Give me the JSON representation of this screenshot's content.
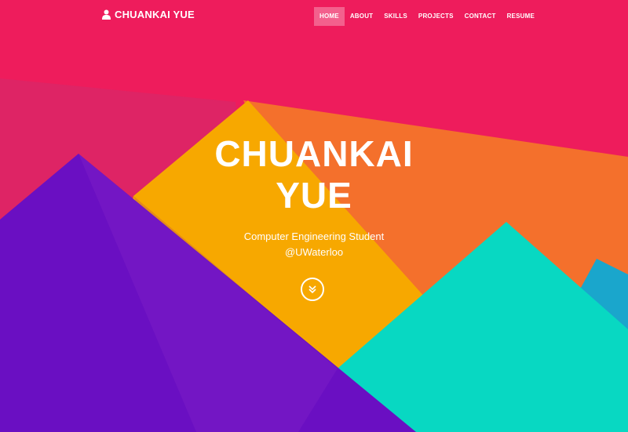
{
  "nav": {
    "brand": "CHUANKAI YUE",
    "brand_icon": "user-icon",
    "items": [
      {
        "label": "HOME",
        "active": true
      },
      {
        "label": "ABOUT"
      },
      {
        "label": "SKILLS"
      },
      {
        "label": "PROJECTS"
      },
      {
        "label": "CONTACT"
      },
      {
        "label": "RESUME"
      }
    ]
  },
  "hero": {
    "title_line1": "CHUANKAI",
    "title_line2": "YUE",
    "subtitle_line1": "Computer Engineering Student",
    "subtitle_line2": "@UWaterloo",
    "scroll_icon": "double-chevron-down-icon"
  },
  "colors": {
    "background": "#ee1c5c",
    "orange": "#f7a800",
    "coral": "#f4702c",
    "purple": "#6a0fc2",
    "teal": "#08d8c2",
    "blue": "#1aa6cc"
  }
}
